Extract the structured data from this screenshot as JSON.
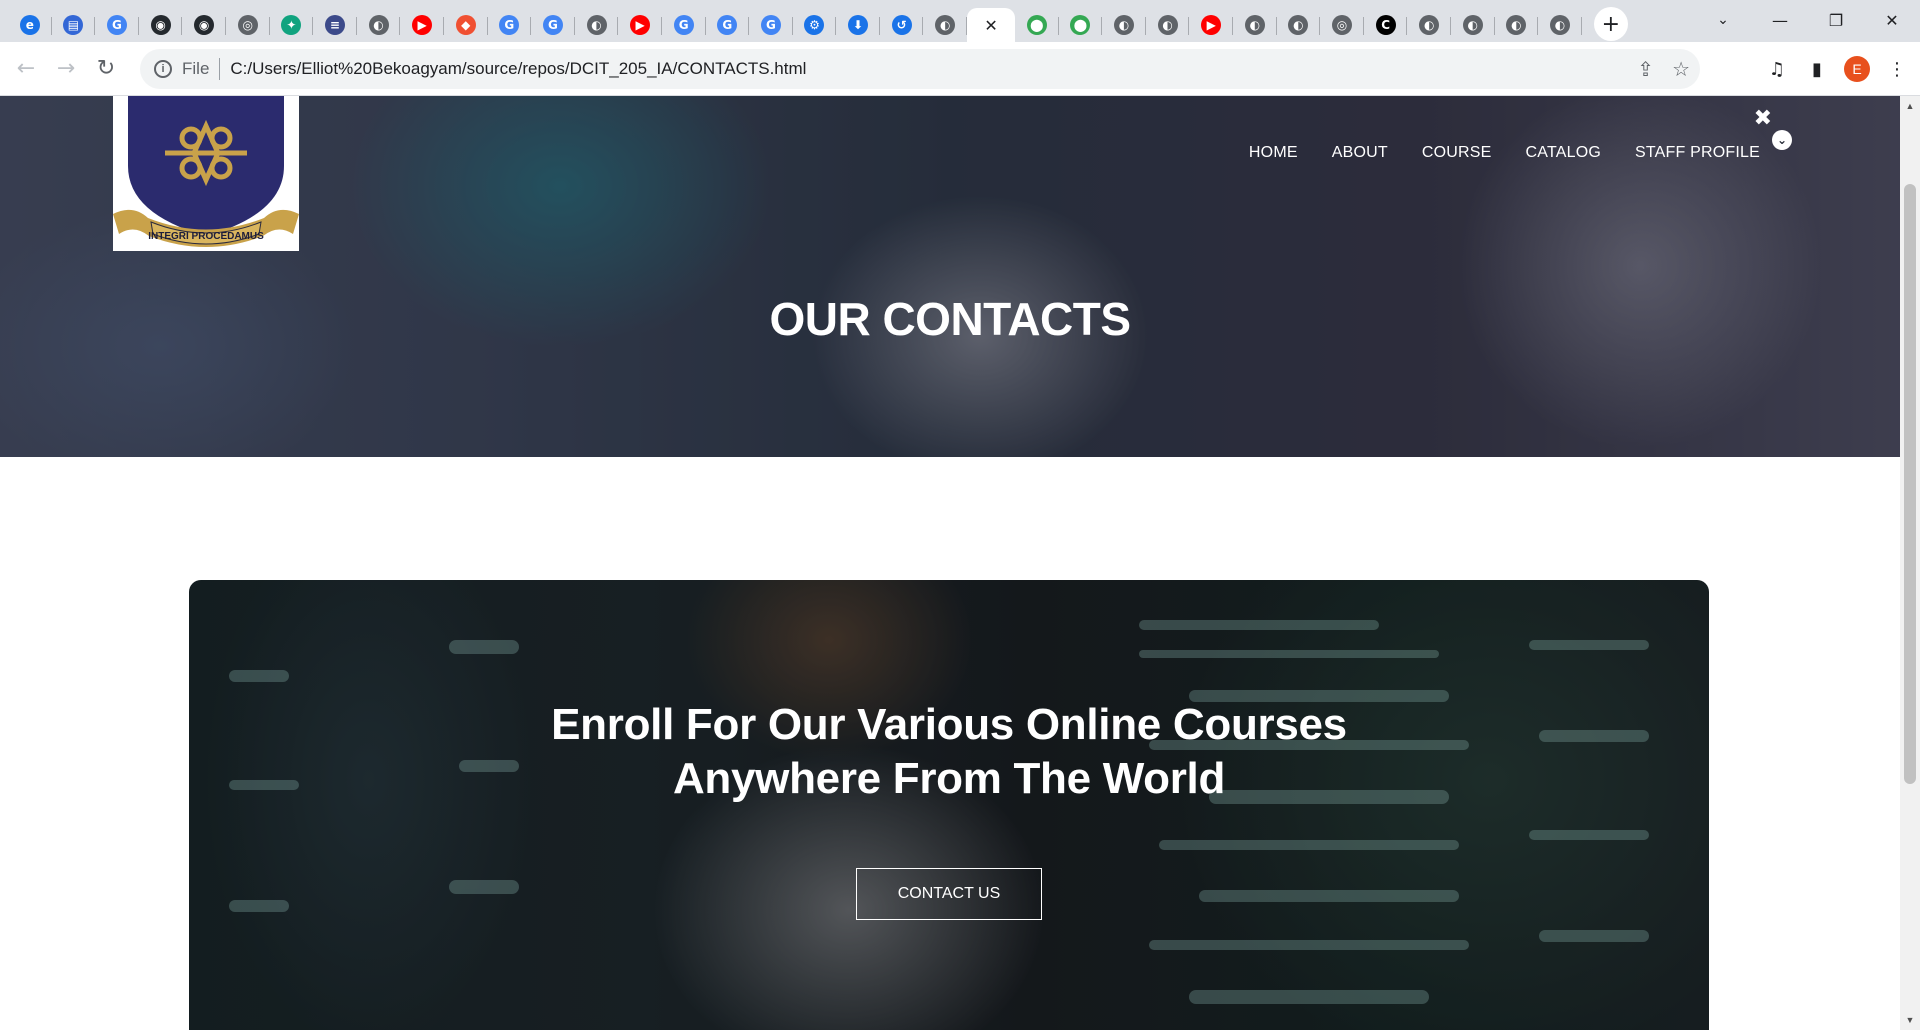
{
  "browser": {
    "tabs": [
      {
        "icon": "edge-icon",
        "color": "#1a73e8",
        "glyph": "e"
      },
      {
        "icon": "printer-icon",
        "color": "#3367d6",
        "glyph": "▤"
      },
      {
        "icon": "google-icon",
        "color": "#4285f4",
        "glyph": "G"
      },
      {
        "icon": "github-icon",
        "color": "#24292e",
        "glyph": "◉"
      },
      {
        "icon": "github-icon",
        "color": "#24292e",
        "glyph": "◉"
      },
      {
        "icon": "chrome-icon",
        "color": "#5f6368",
        "glyph": "◎"
      },
      {
        "icon": "chatgpt-icon",
        "color": "#10a37f",
        "glyph": "✦"
      },
      {
        "icon": "site-icon",
        "color": "#3c4a8a",
        "glyph": "≡"
      },
      {
        "icon": "globe-icon",
        "color": "#5f6368",
        "glyph": "◐"
      },
      {
        "icon": "youtube-icon",
        "color": "#ff0000",
        "glyph": "▶"
      },
      {
        "icon": "git-icon",
        "color": "#f05032",
        "glyph": "◆"
      },
      {
        "icon": "google-icon",
        "color": "#4285f4",
        "glyph": "G"
      },
      {
        "icon": "google-icon",
        "color": "#4285f4",
        "glyph": "G"
      },
      {
        "icon": "globe-icon",
        "color": "#5f6368",
        "glyph": "◐"
      },
      {
        "icon": "youtube-icon",
        "color": "#ff0000",
        "glyph": "▶"
      },
      {
        "icon": "google-icon",
        "color": "#4285f4",
        "glyph": "G"
      },
      {
        "icon": "google-icon",
        "color": "#4285f4",
        "glyph": "G"
      },
      {
        "icon": "google-icon",
        "color": "#4285f4",
        "glyph": "G"
      },
      {
        "icon": "settings-icon",
        "color": "#1a73e8",
        "glyph": "⚙"
      },
      {
        "icon": "download-icon",
        "color": "#1a73e8",
        "glyph": "⬇"
      },
      {
        "icon": "history-icon",
        "color": "#1a73e8",
        "glyph": "↺"
      },
      {
        "icon": "globe-icon",
        "color": "#5f6368",
        "glyph": "◐"
      }
    ],
    "active_tab_close": "✕",
    "tabs_after": [
      {
        "icon": "maps-icon",
        "color": "#34a853",
        "glyph": "⬤"
      },
      {
        "icon": "maps-icon",
        "color": "#34a853",
        "glyph": "⬤"
      },
      {
        "icon": "globe-icon",
        "color": "#5f6368",
        "glyph": "◐"
      },
      {
        "icon": "globe-icon",
        "color": "#5f6368",
        "glyph": "◐"
      },
      {
        "icon": "youtube-icon",
        "color": "#ff0000",
        "glyph": "▶"
      },
      {
        "icon": "globe-icon",
        "color": "#5f6368",
        "glyph": "◐"
      },
      {
        "icon": "globe-icon",
        "color": "#5f6368",
        "glyph": "◐"
      },
      {
        "icon": "chrome-icon",
        "color": "#5f6368",
        "glyph": "◎"
      },
      {
        "icon": "site-icon",
        "color": "#000000",
        "glyph": "C"
      },
      {
        "icon": "globe-icon",
        "color": "#5f6368",
        "glyph": "◐"
      },
      {
        "icon": "globe-icon",
        "color": "#5f6368",
        "glyph": "◐"
      },
      {
        "icon": "globe-icon",
        "color": "#5f6368",
        "glyph": "◐"
      },
      {
        "icon": "globe-icon",
        "color": "#5f6368",
        "glyph": "◐"
      }
    ],
    "new_tab": "+",
    "window": {
      "tab_search": "⌄",
      "minimize": "—",
      "restore": "❐",
      "close": "✕"
    },
    "address": {
      "scheme_label": "File",
      "url": "C:/Users/Elliot%20Bekoagyam/source/repos/DCIT_205_IA/CONTACTS.html"
    },
    "profile_initial": "E"
  },
  "page": {
    "nav": [
      "HOME",
      "ABOUT",
      "COURSE",
      "CATALOG",
      "STAFF PROFILE"
    ],
    "nav_close": "✖",
    "nav_toggle": "⌄",
    "logo_motto": "INTEGRI PROCEDAMUS",
    "hero_title": "OUR CONTACTS",
    "promo_line1": "Enroll For Our Various Online Courses",
    "promo_line2": "Anywhere From The World",
    "promo_button": "CONTACT US"
  }
}
